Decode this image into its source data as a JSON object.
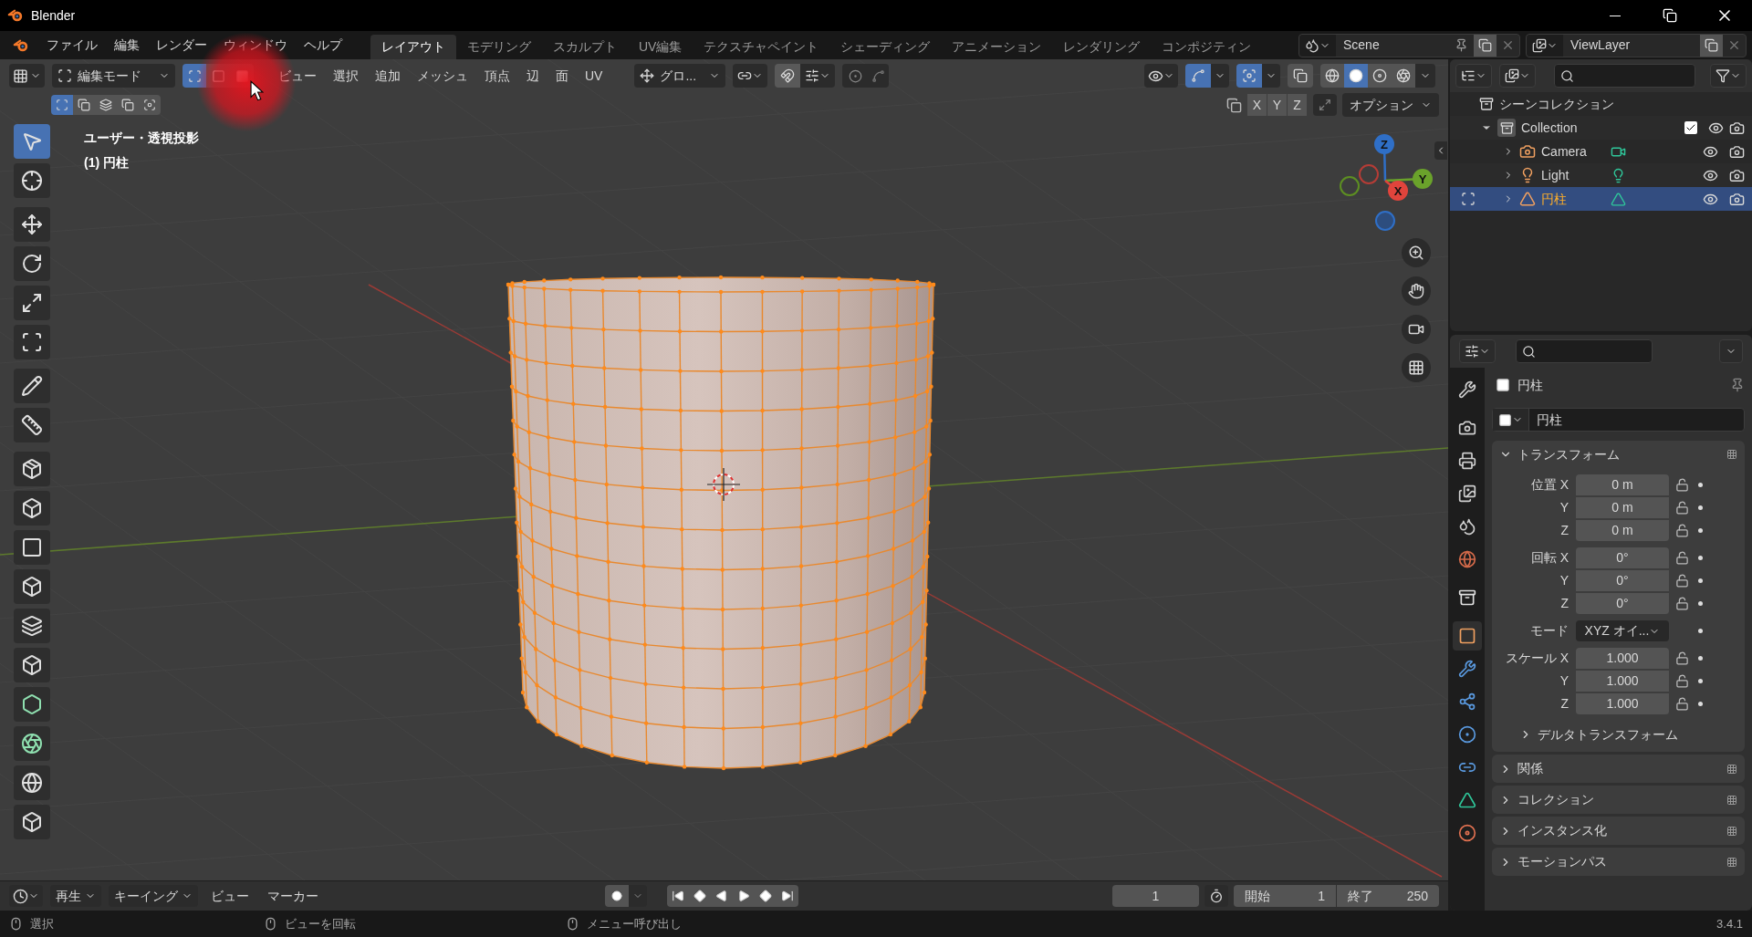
{
  "window": {
    "title": "Blender"
  },
  "menu": [
    "ファイル",
    "編集",
    "レンダー",
    "ウィンドウ",
    "ヘルプ"
  ],
  "workspaces": [
    {
      "label": "レイアウト",
      "selected": true
    },
    {
      "label": "モデリング",
      "selected": false
    },
    {
      "label": "スカルプト",
      "selected": false
    },
    {
      "label": "UV編集",
      "selected": false
    },
    {
      "label": "テクスチャペイント",
      "selected": false
    },
    {
      "label": "シェーディング",
      "selected": false
    },
    {
      "label": "アニメーション",
      "selected": false
    },
    {
      "label": "レンダリング",
      "selected": false
    },
    {
      "label": "コンポジティン",
      "selected": false
    }
  ],
  "scene": {
    "name": "Scene"
  },
  "view_layer": {
    "name": "ViewLayer"
  },
  "viewport_header": {
    "mode": "編集モード",
    "select_modes": [
      {
        "kind": "vertex",
        "selected": true
      },
      {
        "kind": "edge",
        "selected": false
      },
      {
        "kind": "face",
        "selected": false
      }
    ],
    "menus": [
      "ビュー",
      "選択",
      "追加",
      "メッシュ",
      "頂点",
      "辺",
      "面",
      "UV"
    ],
    "orientation": "グロ...",
    "overlays": [
      {
        "kind": "gizmo",
        "on": true
      },
      {
        "kind": "overlay",
        "on": true
      },
      {
        "kind": "xray",
        "on": false
      }
    ],
    "shading": [
      {
        "kind": "wireframe",
        "selected": false
      },
      {
        "kind": "solid",
        "selected": true
      },
      {
        "kind": "material",
        "selected": false
      },
      {
        "kind": "rendered",
        "selected": false
      }
    ],
    "box_modes": [
      {
        "kind": "set",
        "selected": true
      },
      {
        "kind": "extend",
        "selected": false
      },
      {
        "kind": "subtract",
        "selected": false
      },
      {
        "kind": "difference",
        "selected": false
      },
      {
        "kind": "intersect",
        "selected": false
      }
    ],
    "mirror_axes": [
      "X",
      "Y",
      "Z"
    ],
    "options": "オプション"
  },
  "viewport": {
    "view_name": "ユーザー・透視投影",
    "object_label": "(1) 円柱",
    "gizmo_axes": [
      "Z",
      "Y",
      "X"
    ]
  },
  "toolbar": [
    {
      "kind": "select",
      "selected": true
    },
    {
      "kind": "cursor",
      "selected": false
    },
    {
      "kind": "move",
      "selected": false
    },
    {
      "kind": "rotate",
      "selected": false
    },
    {
      "kind": "scale",
      "selected": false
    },
    {
      "kind": "transform",
      "selected": false
    },
    {
      "kind": "annotate",
      "selected": false
    },
    {
      "kind": "measure",
      "selected": false
    },
    {
      "kind": "add_cube",
      "selected": false
    },
    {
      "kind": "extrude",
      "selected": false
    },
    {
      "kind": "inset",
      "selected": false
    },
    {
      "kind": "bevel",
      "selected": false
    },
    {
      "kind": "loop_cut",
      "selected": false
    },
    {
      "kind": "knife",
      "selected": false
    },
    {
      "kind": "poly_build",
      "selected": false
    },
    {
      "kind": "spin",
      "selected": false
    },
    {
      "kind": "smooth",
      "selected": false
    },
    {
      "kind": "shear",
      "selected": false
    }
  ],
  "outliner": {
    "root": "シーンコレクション",
    "collection": {
      "name": "Collection",
      "expanded": true,
      "checked": true,
      "children": [
        {
          "name": "Camera",
          "kind": "camera",
          "expanded": false,
          "selected": false
        },
        {
          "name": "Light",
          "kind": "light",
          "expanded": false,
          "selected": false
        },
        {
          "name": "円柱",
          "kind": "mesh",
          "expanded": false,
          "selected": true
        }
      ]
    }
  },
  "properties": {
    "tabs": [
      {
        "kind": "tool",
        "selected": false
      },
      {
        "kind": "render",
        "selected": false
      },
      {
        "kind": "output",
        "selected": false
      },
      {
        "kind": "view_layer",
        "selected": false
      },
      {
        "kind": "scene",
        "selected": false
      },
      {
        "kind": "world",
        "selected": false
      },
      {
        "kind": "collection",
        "selected": false
      },
      {
        "kind": "object",
        "selected": true
      },
      {
        "kind": "modifiers",
        "selected": false
      },
      {
        "kind": "particles",
        "selected": false
      },
      {
        "kind": "physics",
        "selected": false
      },
      {
        "kind": "constraints",
        "selected": false
      },
      {
        "kind": "data",
        "selected": false
      },
      {
        "kind": "material",
        "selected": false
      }
    ],
    "object_name": "円柱",
    "name_field": "円柱",
    "transform": {
      "title": "トランスフォーム",
      "expanded": true,
      "groups": [
        {
          "rows": [
            {
              "kind": "number",
              "label": "位置 X",
              "value": "0 m"
            },
            {
              "kind": "number",
              "label": "Y",
              "value": "0 m"
            },
            {
              "kind": "number",
              "label": "Z",
              "value": "0 m"
            }
          ]
        },
        {
          "rows": [
            {
              "kind": "number",
              "label": "回転 X",
              "value": "0°"
            },
            {
              "kind": "number",
              "label": "Y",
              "value": "0°"
            },
            {
              "kind": "number",
              "label": "Z",
              "value": "0°"
            }
          ]
        },
        {
          "rows": [
            {
              "kind": "dropdown",
              "label": "モード",
              "value": "XYZ オイ..."
            }
          ]
        },
        {
          "rows": [
            {
              "kind": "number",
              "label": "スケール X",
              "value": "1.000"
            },
            {
              "kind": "number",
              "label": "Y",
              "value": "1.000"
            },
            {
              "kind": "number",
              "label": "Z",
              "value": "1.000"
            }
          ]
        }
      ],
      "subpanel": {
        "title": "デルタトランスフォーム",
        "expanded": false
      }
    },
    "panels": [
      {
        "title": "関係",
        "expanded": false
      },
      {
        "title": "コレクション",
        "expanded": false
      },
      {
        "title": "インスタンス化",
        "expanded": false
      },
      {
        "title": "モーションパス",
        "expanded": false
      }
    ]
  },
  "timeline": {
    "menus": [
      {
        "label": "再生",
        "dropdown": true
      },
      {
        "label": "キーイング",
        "dropdown": true
      },
      {
        "label": "ビュー",
        "dropdown": false
      },
      {
        "label": "マーカー",
        "dropdown": false
      }
    ],
    "current_frame": "1",
    "start_label": "開始",
    "start": "1",
    "end_label": "終了",
    "end": "250"
  },
  "status_bar": {
    "hints": [
      "選択",
      "ビューを回転",
      "メニュー呼び出し"
    ],
    "version": "3.4.1"
  }
}
